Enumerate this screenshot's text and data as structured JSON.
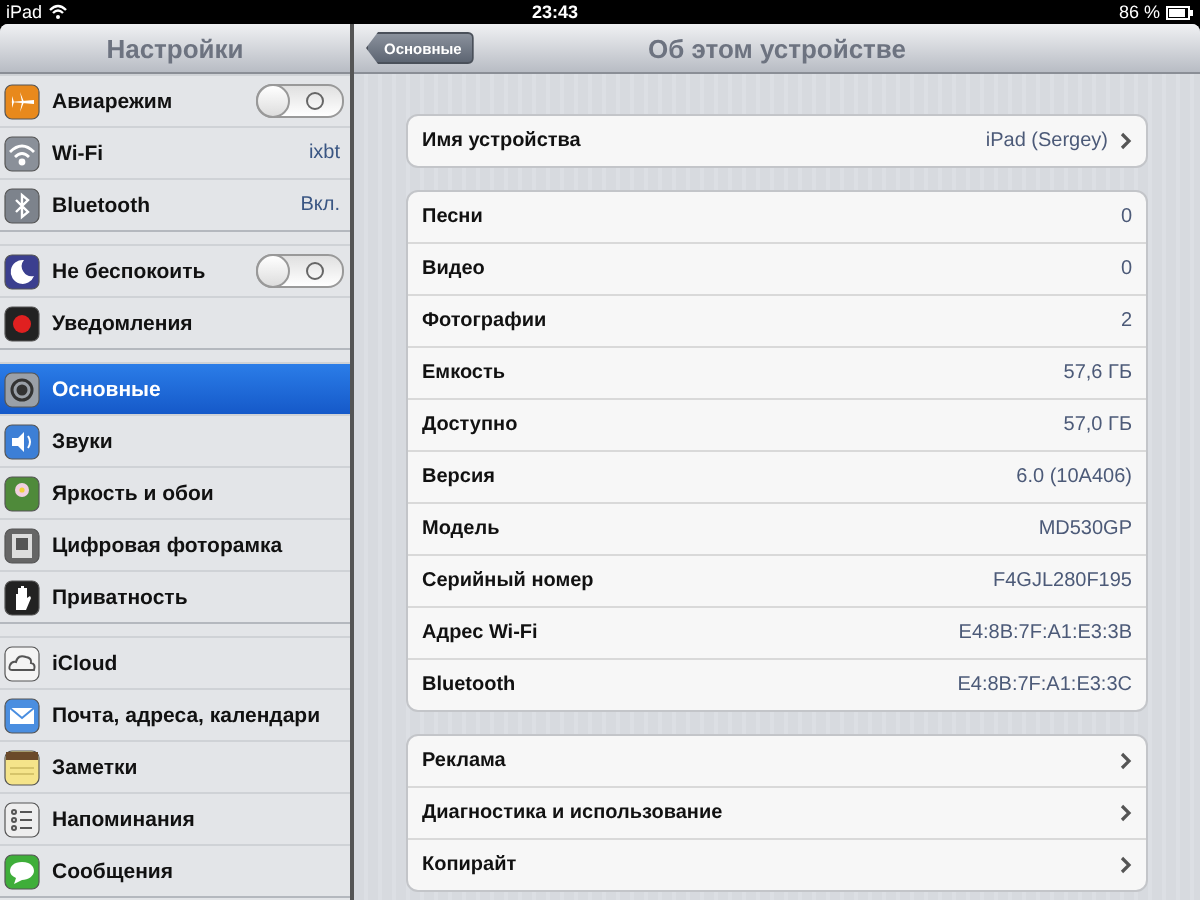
{
  "status_bar": {
    "device": "iPad",
    "time": "23:43",
    "battery": "86 %"
  },
  "sidebar": {
    "title": "Настройки",
    "groups": [
      {
        "items": [
          {
            "label": "Авиарежим",
            "kind": "toggle",
            "on": false,
            "selected": false
          },
          {
            "label": "Wi-Fi",
            "kind": "value",
            "value": "ixbt",
            "selected": false
          },
          {
            "label": "Bluetooth",
            "kind": "value",
            "value": "Вкл.",
            "selected": false
          }
        ]
      },
      {
        "items": [
          {
            "label": "Не беспокоить",
            "kind": "toggle",
            "on": false,
            "selected": false
          },
          {
            "label": "Уведомления",
            "kind": "plain",
            "selected": false
          }
        ]
      },
      {
        "items": [
          {
            "label": "Основные",
            "kind": "plain",
            "selected": true
          },
          {
            "label": "Звуки",
            "kind": "plain",
            "selected": false
          },
          {
            "label": "Яркость и обои",
            "kind": "plain",
            "selected": false
          },
          {
            "label": "Цифровая фоторамка",
            "kind": "plain",
            "selected": false
          },
          {
            "label": "Приватность",
            "kind": "plain",
            "selected": false
          }
        ]
      },
      {
        "items": [
          {
            "label": "iCloud",
            "kind": "plain",
            "selected": false
          },
          {
            "label": "Почта, адреса, календари",
            "kind": "plain",
            "selected": false
          },
          {
            "label": "Заметки",
            "kind": "plain",
            "selected": false
          },
          {
            "label": "Напоминания",
            "kind": "plain",
            "selected": false
          },
          {
            "label": "Сообщения",
            "kind": "plain",
            "selected": false
          }
        ]
      }
    ]
  },
  "detail": {
    "back_button": "Основные",
    "title": "Об этом устройстве",
    "groups": [
      {
        "rows": [
          {
            "label": "Имя устройства",
            "value": "iPad (Sergey)",
            "disclosure": true
          }
        ]
      },
      {
        "rows": [
          {
            "label": "Песни",
            "value": "0",
            "disclosure": false
          },
          {
            "label": "Видео",
            "value": "0",
            "disclosure": false
          },
          {
            "label": "Фотографии",
            "value": "2",
            "disclosure": false
          },
          {
            "label": "Емкость",
            "value": "57,6 ГБ",
            "disclosure": false
          },
          {
            "label": "Доступно",
            "value": "57,0 ГБ",
            "disclosure": false
          },
          {
            "label": "Версия",
            "value": "6.0 (10A406)",
            "disclosure": false
          },
          {
            "label": "Модель",
            "value": "MD530GP",
            "disclosure": false
          },
          {
            "label": "Серийный номер",
            "value": "F4GJL280F195",
            "disclosure": false
          },
          {
            "label": "Адрес Wi-Fi",
            "value": "E4:8B:7F:A1:E3:3B",
            "disclosure": false
          },
          {
            "label": "Bluetooth",
            "value": "E4:8B:7F:A1:E3:3C",
            "disclosure": false
          }
        ]
      },
      {
        "rows": [
          {
            "label": "Реклама",
            "disclosure": true
          },
          {
            "label": "Диагностика и использование",
            "disclosure": true
          },
          {
            "label": "Копирайт",
            "disclosure": true
          }
        ]
      }
    ]
  }
}
